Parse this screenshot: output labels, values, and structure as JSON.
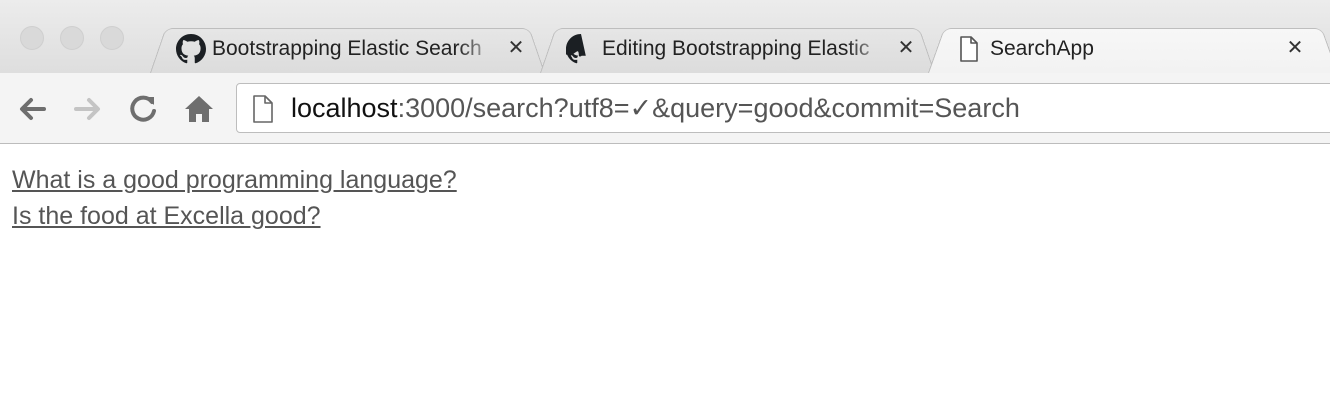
{
  "tabs": [
    {
      "title": "Bootstrapping Elastic Search",
      "icon": "github-icon",
      "active": false
    },
    {
      "title": "Editing Bootstrapping Elastic",
      "icon": "github-icon",
      "active": false
    },
    {
      "title": "SearchApp",
      "icon": "page-icon",
      "active": true
    }
  ],
  "toolbar": {
    "address_host": "localhost",
    "address_path": ":3000/search?utf8=✓&query=good&commit=Search"
  },
  "results": [
    {
      "text": "What is a good programming language?"
    },
    {
      "text": "Is the food at Excella good?"
    }
  ],
  "colors": {
    "link": "#555555",
    "toolbar_bg": "#f4f4f4",
    "tabstrip_bg": "#dedede"
  }
}
